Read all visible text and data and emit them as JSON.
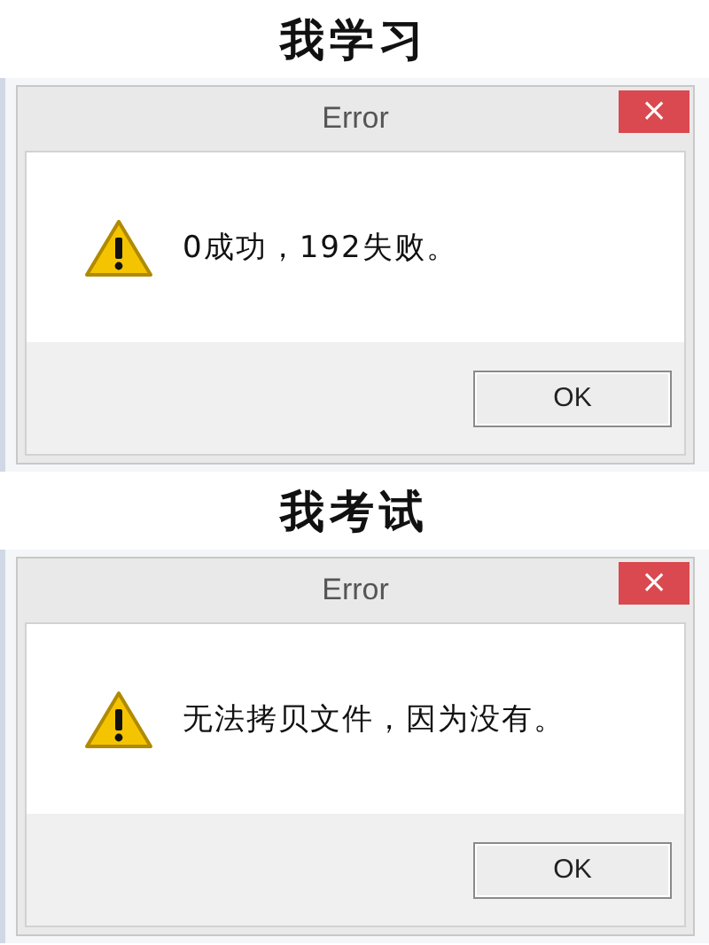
{
  "panels": [
    {
      "caption": "我学习",
      "dialog": {
        "title": "Error",
        "close": "×",
        "message": "0成功，192失败。",
        "button": "OK"
      }
    },
    {
      "caption": "我考试",
      "dialog": {
        "title": "Error",
        "close": "×",
        "message": "无法拷贝文件，因为没有。",
        "button": "OK"
      }
    }
  ]
}
